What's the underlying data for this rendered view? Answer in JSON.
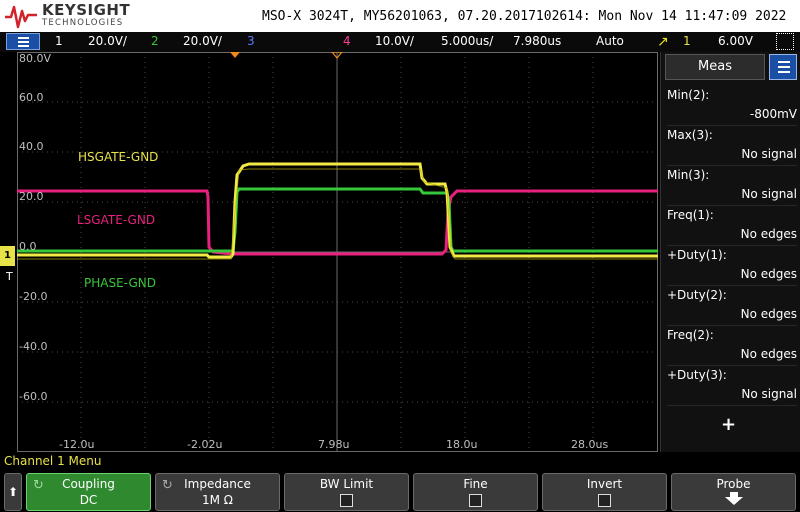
{
  "header": {
    "brand": "KEYSIGHT",
    "brand_sub": "TECHNOLOGIES",
    "scope_info": "MSO-X 3024T, MY56201063, 07.20.2017102614: Mon Nov 14 11:47:09 2022"
  },
  "channel_bar": {
    "ch1_num": "1",
    "ch1_scale": "20.0V/",
    "ch2_num": "2",
    "ch2_scale": "20.0V/",
    "ch3_num": "3",
    "ch4_num": "4",
    "ch4_scale": "10.0V/",
    "timebase": "5.000us/",
    "delay": "7.980us",
    "trigger_mode": "Auto",
    "trigger_source": "1",
    "trigger_level": "6.00V",
    "colors": {
      "ch1": "#e8e24a",
      "ch2": "#36c83a",
      "ch3": "#5a7bff",
      "ch4": "#ff3c9a"
    }
  },
  "graticule": {
    "y_labels": [
      "80.0V",
      "60.0",
      "40.0",
      "20.0",
      "0.0",
      "-20.0",
      "-40.0",
      "-60.0"
    ],
    "x_labels": [
      "-12.0u",
      "-2.02u",
      "7.98u",
      "18.0u",
      "28.0us"
    ],
    "t_marker": "T",
    "ch1_marker": "1"
  },
  "traces": {
    "hsgate_label": "HSGATE-GND",
    "lsgate_label": "LSGATE-GND",
    "phase_label": "PHASE-GND",
    "hsgate_color": "#e8e24a",
    "lsgate_color": "#e8217e",
    "phase_color": "#36c83a"
  },
  "meas_panel": {
    "title": "Meas",
    "items": [
      {
        "name": "Min(2):",
        "value": "-800mV"
      },
      {
        "name": "Max(3):",
        "value": "No signal"
      },
      {
        "name": "Min(3):",
        "value": "No signal"
      },
      {
        "name": "Freq(1):",
        "value": "No edges"
      },
      {
        "name": "+Duty(1):",
        "value": "No edges"
      },
      {
        "name": "+Duty(2):",
        "value": "No edges"
      },
      {
        "name": "Freq(2):",
        "value": "No edges"
      },
      {
        "name": "+Duty(3):",
        "value": "No signal"
      }
    ],
    "add_label": "+"
  },
  "menu": {
    "title": "Channel 1 Menu",
    "back_label": "⬆",
    "coupling_label": "Coupling",
    "coupling_value": "DC",
    "impedance_label": "Impedance",
    "impedance_value": "1M Ω",
    "bwlimit_label": "BW Limit",
    "fine_label": "Fine",
    "invert_label": "Invert",
    "probe_label": "Probe"
  }
}
